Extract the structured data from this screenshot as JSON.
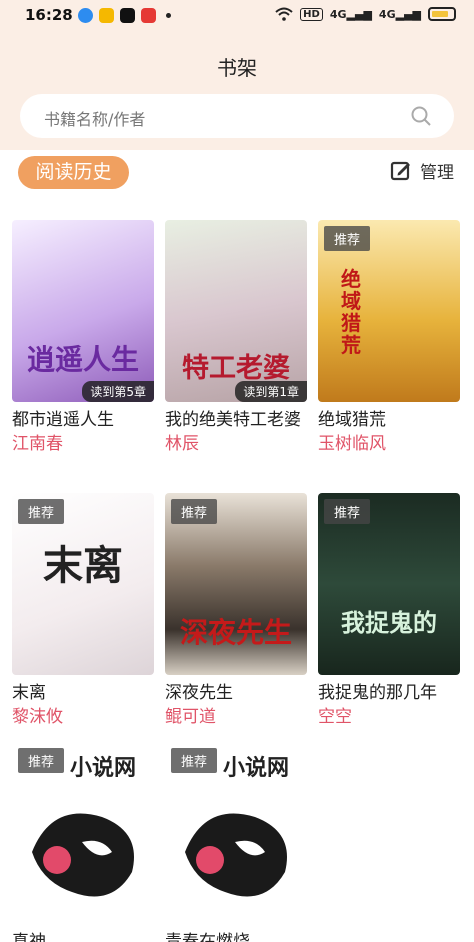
{
  "status": {
    "time": "16:28",
    "hd": "HD",
    "sig1": "4G",
    "sig2": "4G"
  },
  "header": {
    "title": "书架"
  },
  "search": {
    "placeholder": "书籍名称/作者"
  },
  "toolbar": {
    "history_label": "阅读历史",
    "manage_label": "管理"
  },
  "books": [
    {
      "title": "都市逍遥人生",
      "author": "江南春",
      "badge": "",
      "progress": "读到第5章",
      "cover_text": "逍遥人生"
    },
    {
      "title": "我的绝美特工老婆",
      "author": "林辰",
      "badge": "",
      "progress": "读到第1章",
      "cover_text": "特工老婆"
    },
    {
      "title": "绝域猎荒",
      "author": "玉树临风",
      "badge": "推荐",
      "progress": "",
      "cover_text": "绝域猎荒"
    },
    {
      "title": "末离",
      "author": "黎沫攸",
      "badge": "推荐",
      "progress": "",
      "cover_text": "末离"
    },
    {
      "title": "深夜先生",
      "author": "鲲可道",
      "badge": "推荐",
      "progress": "",
      "cover_text": "深夜先生"
    },
    {
      "title": "我捉鬼的那几年",
      "author": "空空",
      "badge": "推荐",
      "progress": "",
      "cover_text": "我捉鬼的"
    },
    {
      "title": "真神",
      "author": "",
      "badge": "推荐",
      "progress": "",
      "cover_text": "小说网"
    },
    {
      "title": "青春在燃烧",
      "author": "",
      "badge": "推荐",
      "progress": "",
      "cover_text": "小说网"
    }
  ],
  "colors": {
    "accent": "#f0a060",
    "author": "#e05468",
    "header_bg": "#fbeee5"
  }
}
